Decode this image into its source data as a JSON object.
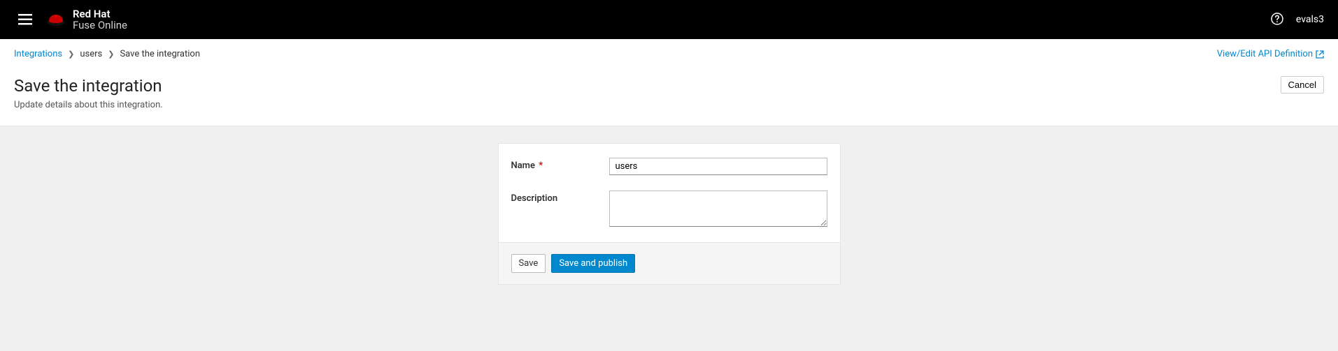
{
  "header": {
    "brand_line1": "Red Hat",
    "brand_line2": "Fuse Online",
    "username": "evals3"
  },
  "breadcrumb": {
    "item1": "Integrations",
    "item2": "users",
    "item3": "Save the integration"
  },
  "top_link": "View/Edit API Definition",
  "page": {
    "title": "Save the integration",
    "subtitle": "Update details about this integration.",
    "cancel": "Cancel"
  },
  "form": {
    "name_label": "Name",
    "name_value": "users",
    "description_label": "Description",
    "description_value": ""
  },
  "actions": {
    "save": "Save",
    "save_publish": "Save and publish"
  }
}
